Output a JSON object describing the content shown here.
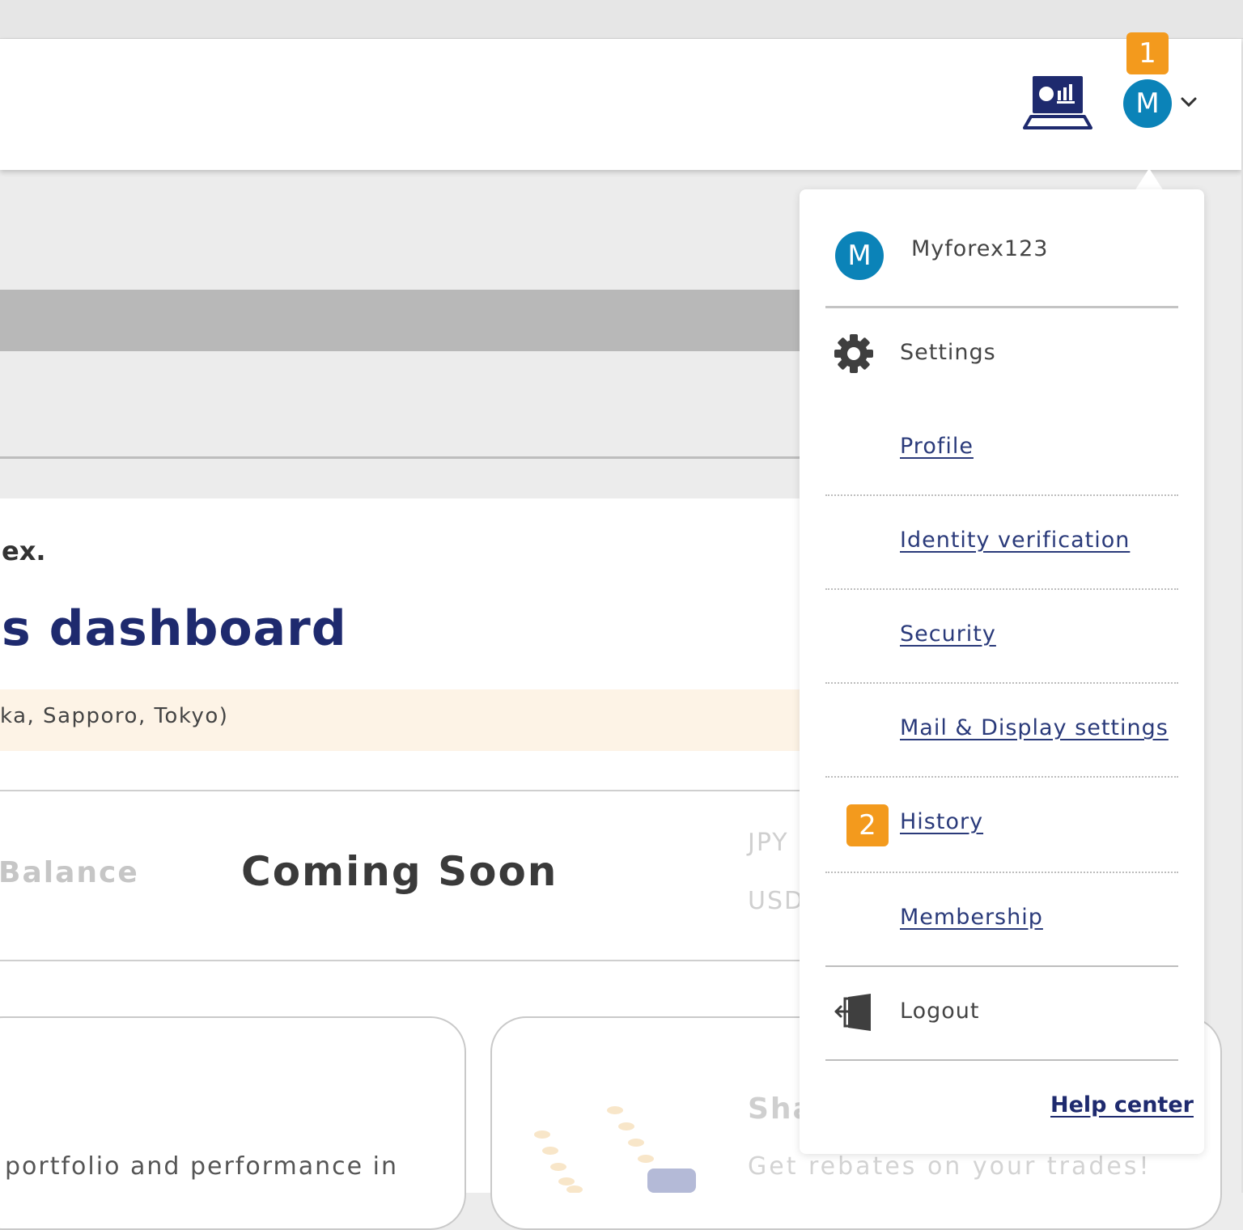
{
  "header": {
    "avatar_initial": "M",
    "notification_badge": "1",
    "icons": [
      "desktop-trading-icon",
      "chevron-down-icon"
    ]
  },
  "main": {
    "welcome_tail": "ex.",
    "dashboard_title": "s dashboard",
    "notice_text": "ka, Sapporo, Tokyo)",
    "balance_label": "Balance",
    "coming_soon": "Coming Soon",
    "currencies": [
      "JPY",
      "USD"
    ],
    "portfolio_text": "portfolio and performance in",
    "share_title": "Sha",
    "rebate_text": "Get rebates on your trades!"
  },
  "dropdown": {
    "avatar_initial": "M",
    "username": "Myforex123",
    "settings_label": "Settings",
    "links": [
      {
        "label": "Profile"
      },
      {
        "label": "Identity verification"
      },
      {
        "label": "Security"
      },
      {
        "label": "Mail & Display settings"
      },
      {
        "label": "History",
        "badge": "2"
      },
      {
        "label": "Membership"
      }
    ],
    "logout_label": "Logout",
    "help_center_label": "Help center"
  },
  "colors": {
    "brand_navy": "#1e2a6e",
    "avatar_blue": "#0b83b8",
    "badge_orange": "#f39a1d",
    "notice_bg": "#fdf3e6"
  }
}
